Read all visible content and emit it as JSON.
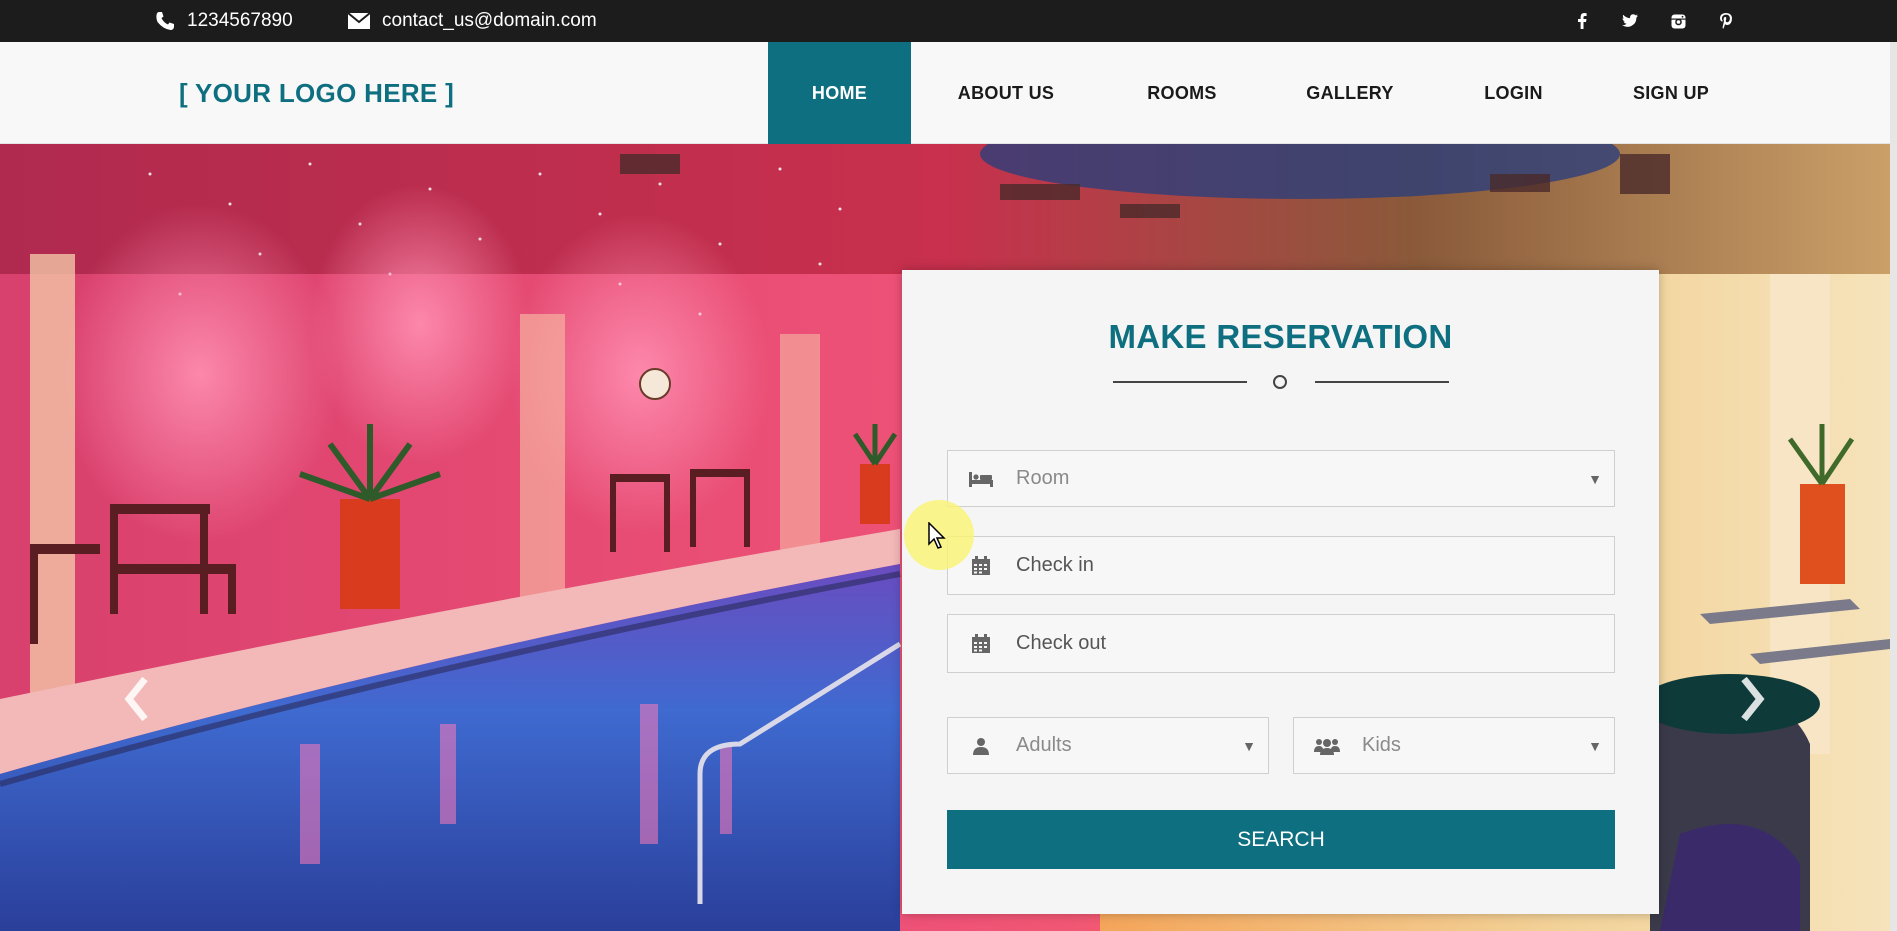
{
  "topbar": {
    "phone": "1234567890",
    "email": "contact_us@domain.com",
    "social": [
      "facebook-icon",
      "twitter-icon",
      "instagram-icon",
      "pinterest-icon"
    ]
  },
  "navbar": {
    "logo": "[ YOUR LOGO HERE ]",
    "items": [
      {
        "label": "HOME",
        "active": true
      },
      {
        "label": "ABOUT US",
        "active": false
      },
      {
        "label": "ROOMS",
        "active": false
      },
      {
        "label": "GALLERY",
        "active": false
      },
      {
        "label": "LOGIN",
        "active": false
      },
      {
        "label": "SIGN UP",
        "active": false
      }
    ]
  },
  "hero": {
    "carousel_controls": [
      "chevron-left-icon",
      "chevron-right-icon"
    ]
  },
  "reservation": {
    "title": "MAKE RESERVATION",
    "room_placeholder": "Room",
    "checkin_placeholder": "Check in",
    "checkout_placeholder": "Check out",
    "adults_placeholder": "Adults",
    "kids_placeholder": "Kids",
    "search_label": "SEARCH"
  },
  "colors": {
    "brand": "#0e6f80",
    "topbar": "#1c1c1c",
    "navbar": "#f8f8f8",
    "card": "#f5f5f5"
  }
}
